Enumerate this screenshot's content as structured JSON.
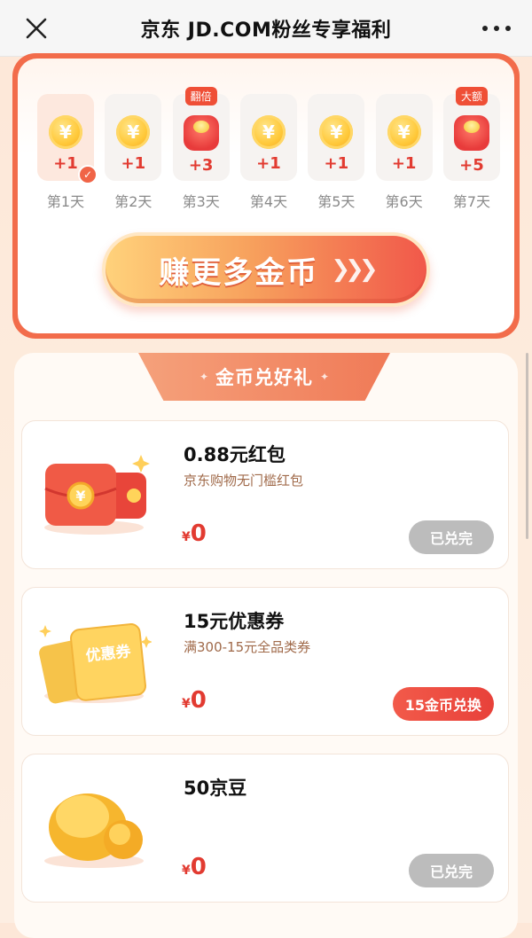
{
  "nav": {
    "title": "京东 JD.COM粉丝专享福利"
  },
  "signin": {
    "days": [
      {
        "label": "第1天",
        "reward": "+1",
        "type": "coin",
        "badge": "",
        "checked": true
      },
      {
        "label": "第2天",
        "reward": "+1",
        "type": "coin",
        "badge": ""
      },
      {
        "label": "第3天",
        "reward": "+3",
        "type": "redpack",
        "badge": "翻倍"
      },
      {
        "label": "第4天",
        "reward": "+1",
        "type": "coin",
        "badge": ""
      },
      {
        "label": "第5天",
        "reward": "+1",
        "type": "coin",
        "badge": ""
      },
      {
        "label": "第6天",
        "reward": "+1",
        "type": "coin",
        "badge": ""
      },
      {
        "label": "第7天",
        "reward": "+5",
        "type": "redpack",
        "badge": "大额"
      }
    ],
    "earn_button": "赚更多金币",
    "coin_symbol": "¥",
    "check_mark": "✓",
    "arrows": "❯❯❯"
  },
  "exchange": {
    "title": "金币兑好礼",
    "deco_left": "✦",
    "deco_right": "✦",
    "items": [
      {
        "title": "0.88元红包",
        "subtitle": "京东购物无门槛红包",
        "currency": "¥",
        "price": "0",
        "button": "已兑完",
        "status": "done",
        "icon": "red-envelope-icon"
      },
      {
        "title": "15元优惠券",
        "subtitle": "满300-15元全品类券",
        "currency": "¥",
        "price": "0",
        "button": "15金币兑换",
        "status": "redeem",
        "icon": "coupon-icon",
        "coupon_text": "优惠券"
      },
      {
        "title": "50京豆",
        "subtitle": "",
        "currency": "¥",
        "price": "0",
        "button": "已兑完",
        "status": "done",
        "icon": "jd-bean-icon"
      }
    ]
  },
  "colors": {
    "accent": "#f26c4b",
    "price_red": "#e23b31",
    "done_gray": "#bcbcbc"
  }
}
